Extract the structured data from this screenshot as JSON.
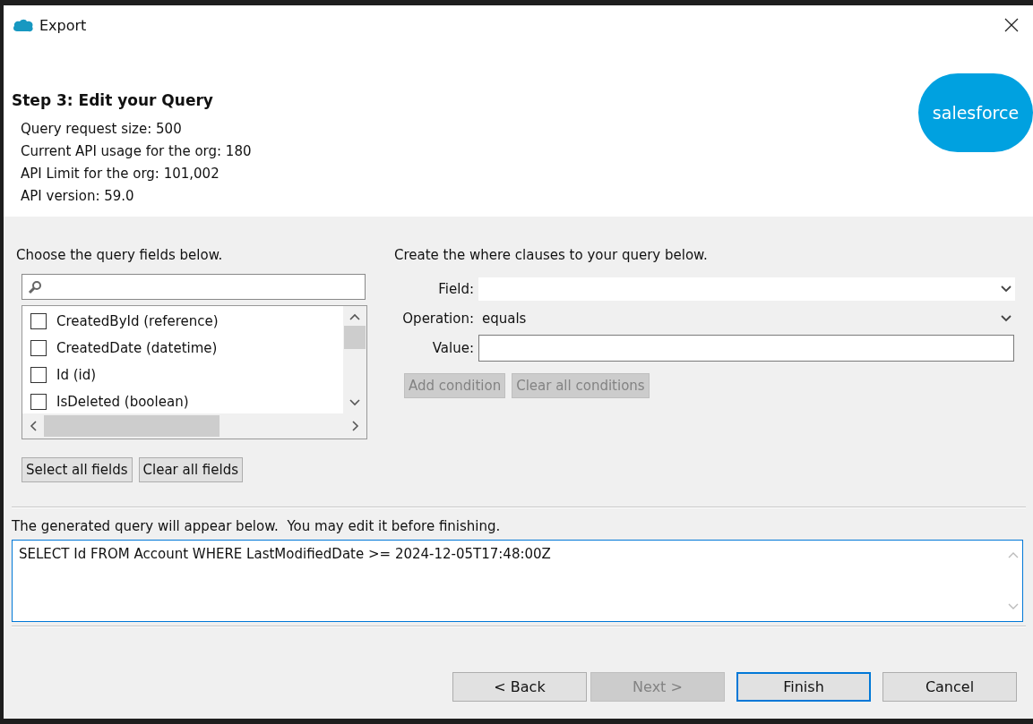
{
  "window": {
    "title": "Export"
  },
  "header": {
    "step_title": "Step 3: Edit your Query",
    "info_lines": [
      "Query request size: 500",
      "Current API usage for the org: 180",
      "API Limit for the org: 101,002",
      "API version: 59.0"
    ],
    "logo_text": "salesforce"
  },
  "fields_panel": {
    "instruction": "Choose the query fields below.",
    "fields": [
      {
        "label": "CreatedById (reference)",
        "checked": false
      },
      {
        "label": "CreatedDate (datetime)",
        "checked": false
      },
      {
        "label": "Id (id)",
        "checked": false
      },
      {
        "label": "IsDeleted (boolean)",
        "checked": false
      }
    ],
    "buttons": [
      {
        "label": "Select all fields",
        "disabled": false
      },
      {
        "label": "Clear all fields",
        "disabled": false
      }
    ]
  },
  "where_panel": {
    "instruction": "Create the where clauses to your query below.",
    "field": {
      "label": "Field:"
    },
    "operation": {
      "label": "Operation:",
      "value": "equals"
    },
    "value": {
      "label": "Value:"
    },
    "buttons": [
      {
        "label": "Add condition",
        "disabled": true
      },
      {
        "label": "Clear all conditions",
        "disabled": true
      }
    ]
  },
  "query": {
    "instruction": "The generated query will appear below.  You may edit it before finishing.",
    "text": "SELECT Id FROM Account WHERE LastModifiedDate >= 2024-12-05T17:48:00Z"
  },
  "footer_buttons": [
    {
      "label": "< Back",
      "disabled": false,
      "default": false
    },
    {
      "label": "Next >",
      "disabled": true,
      "default": false
    },
    {
      "label": "Finish",
      "disabled": false,
      "default": true
    },
    {
      "label": "Cancel",
      "disabled": false,
      "default": false
    }
  ]
}
